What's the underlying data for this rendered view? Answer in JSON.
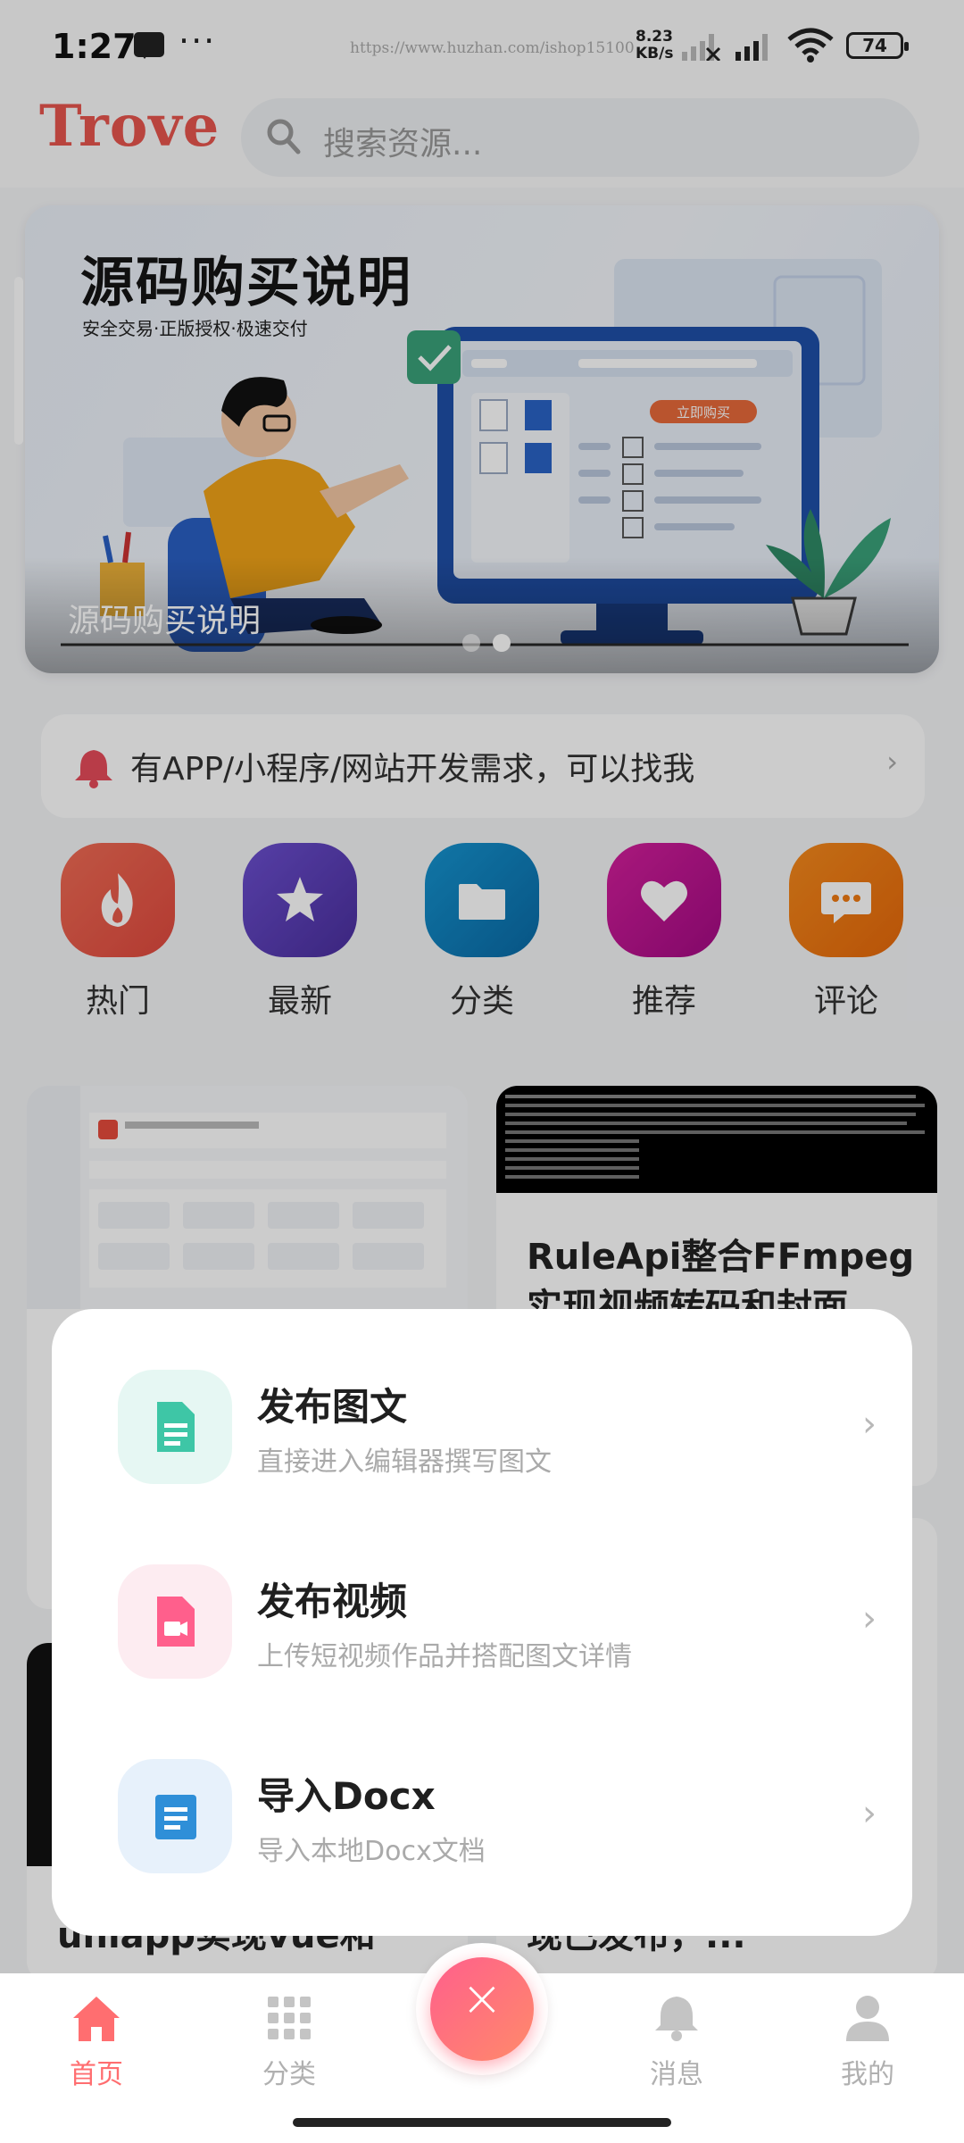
{
  "status_bar": {
    "time": "1:27",
    "dots": "···",
    "url": "https://www.huzhan.com/ishop15100",
    "speed_value": "8.23",
    "speed_unit": "KB/s",
    "battery": "74"
  },
  "header": {
    "logo": "Trove",
    "search_placeholder": "搜索资源..."
  },
  "banner": {
    "title": "源码购买说明",
    "subtitle": "安全交易·正版授权·极速交付",
    "button_text": "立即购买",
    "caption": "源码购买说明",
    "slides": 2,
    "active_slide": 2
  },
  "notice": {
    "text": "有APP/小程序/网站开发需求，可以找我",
    "arrow": "›"
  },
  "quick_menu": [
    {
      "label": "热门",
      "icon": "flame-icon",
      "color": "#e85a4a"
    },
    {
      "label": "最新",
      "icon": "star-icon",
      "color": "#5b3fb8"
    },
    {
      "label": "分类",
      "icon": "folder-icon",
      "color": "#0b7fb8"
    },
    {
      "label": "推荐",
      "icon": "heart-icon",
      "color": "#c4168f"
    },
    {
      "label": "评论",
      "icon": "chat-icon",
      "color": "#ef7a12"
    }
  ],
  "feed": {
    "card_right_title": "RuleApi整合FFmpeg实现视频转码和封面",
    "card_bottom_left_title": "uniapp实现vue和nvue",
    "card_bottom_right_title": "现已发布，..."
  },
  "publish_sheet": {
    "options": [
      {
        "title": "发布图文",
        "desc": "直接进入编辑器撰写图文",
        "icon": "document-icon",
        "bg": "#e6f7f3",
        "fg": "#3ec6a6"
      },
      {
        "title": "发布视频",
        "desc": "上传短视频作品并搭配图文详情",
        "icon": "video-file-icon",
        "bg": "#fdecf1",
        "fg": "#ff5f8c"
      },
      {
        "title": "导入Docx",
        "desc": "导入本地Docx文档",
        "icon": "docx-icon",
        "bg": "#e7f1fb",
        "fg": "#2f8fd8"
      }
    ],
    "arrow": "›"
  },
  "tab_bar": {
    "tabs": [
      {
        "label": "首页",
        "icon": "home-icon"
      },
      {
        "label": "分类",
        "icon": "grid-icon"
      },
      {
        "label": "消息",
        "icon": "bell-icon"
      },
      {
        "label": "我的",
        "icon": "user-icon"
      }
    ],
    "active_index": 0,
    "fab_symbol": "×"
  },
  "colors": {
    "accent": "#ff6e70",
    "logo": "#e8554e"
  }
}
